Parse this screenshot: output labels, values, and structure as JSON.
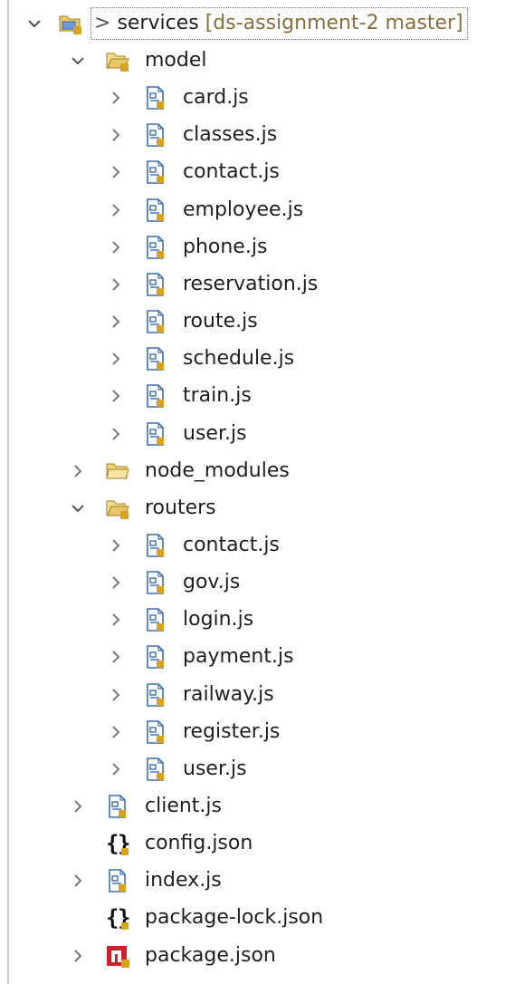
{
  "root": {
    "label": "services",
    "prefix": ">",
    "decoration": "[ds-assignment-2 master]",
    "expanded": true
  },
  "items": [
    {
      "label": "model",
      "level": 1,
      "icon": "folder-open-icon",
      "expanded": true
    },
    {
      "label": "card.js",
      "level": 2,
      "icon": "js-file-icon",
      "expanded": false
    },
    {
      "label": "classes.js",
      "level": 2,
      "icon": "js-file-icon",
      "expanded": false
    },
    {
      "label": "contact.js",
      "level": 2,
      "icon": "js-file-icon",
      "expanded": false
    },
    {
      "label": "employee.js",
      "level": 2,
      "icon": "js-file-icon",
      "expanded": false
    },
    {
      "label": "phone.js",
      "level": 2,
      "icon": "js-file-icon",
      "expanded": false
    },
    {
      "label": "reservation.js",
      "level": 2,
      "icon": "js-file-icon",
      "expanded": false
    },
    {
      "label": "route.js",
      "level": 2,
      "icon": "js-file-icon",
      "expanded": false
    },
    {
      "label": "schedule.js",
      "level": 2,
      "icon": "js-file-icon",
      "expanded": false
    },
    {
      "label": "train.js",
      "level": 2,
      "icon": "js-file-icon",
      "expanded": false
    },
    {
      "label": "user.js",
      "level": 2,
      "icon": "js-file-icon",
      "expanded": false
    },
    {
      "label": "node_modules",
      "level": 1,
      "icon": "folder-closed-icon",
      "expanded": false
    },
    {
      "label": "routers",
      "level": 1,
      "icon": "folder-open-icon",
      "expanded": true
    },
    {
      "label": "contact.js",
      "level": 2,
      "icon": "js-file-icon",
      "expanded": false
    },
    {
      "label": "gov.js",
      "level": 2,
      "icon": "js-file-icon",
      "expanded": false
    },
    {
      "label": "login.js",
      "level": 2,
      "icon": "js-file-icon",
      "expanded": false
    },
    {
      "label": "payment.js",
      "level": 2,
      "icon": "js-file-icon",
      "expanded": false
    },
    {
      "label": "railway.js",
      "level": 2,
      "icon": "js-file-icon",
      "expanded": false
    },
    {
      "label": "register.js",
      "level": 2,
      "icon": "js-file-icon",
      "expanded": false
    },
    {
      "label": "user.js",
      "level": 2,
      "icon": "js-file-icon",
      "expanded": false
    },
    {
      "label": "client.js",
      "level": 1,
      "icon": "js-file-icon",
      "expanded": false
    },
    {
      "label": "config.json",
      "level": 1,
      "icon": "json-file-icon",
      "chevron": false
    },
    {
      "label": "index.js",
      "level": 1,
      "icon": "js-file-icon",
      "expanded": false
    },
    {
      "label": "package-lock.json",
      "level": 1,
      "icon": "json-file-icon",
      "chevron": false
    },
    {
      "label": "package.json",
      "level": 1,
      "icon": "npm-package-icon",
      "expanded": false
    }
  ],
  "colors": {
    "text": "#1f1f1f",
    "chevron": "#555555",
    "folder": "#e8c66a",
    "folder_edge": "#a77f1d",
    "js_blue": "#3b6fb6",
    "repo_badge": "#d8a21c",
    "npm_red": "#c8242b",
    "decoration": "#8a6d3b"
  }
}
